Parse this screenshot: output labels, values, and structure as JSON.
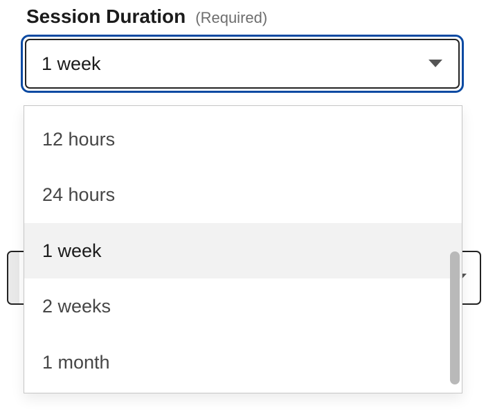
{
  "field": {
    "label": "Session Duration",
    "required_hint": "(Required)",
    "selected_value": "1 week",
    "options": [
      {
        "label": "12 hours",
        "selected": false
      },
      {
        "label": "24 hours",
        "selected": false
      },
      {
        "label": "1 week",
        "selected": true
      },
      {
        "label": "2 weeks",
        "selected": false
      },
      {
        "label": "1 month",
        "selected": false
      }
    ]
  },
  "icons": {
    "chevron_down": "chevron-down-icon"
  }
}
